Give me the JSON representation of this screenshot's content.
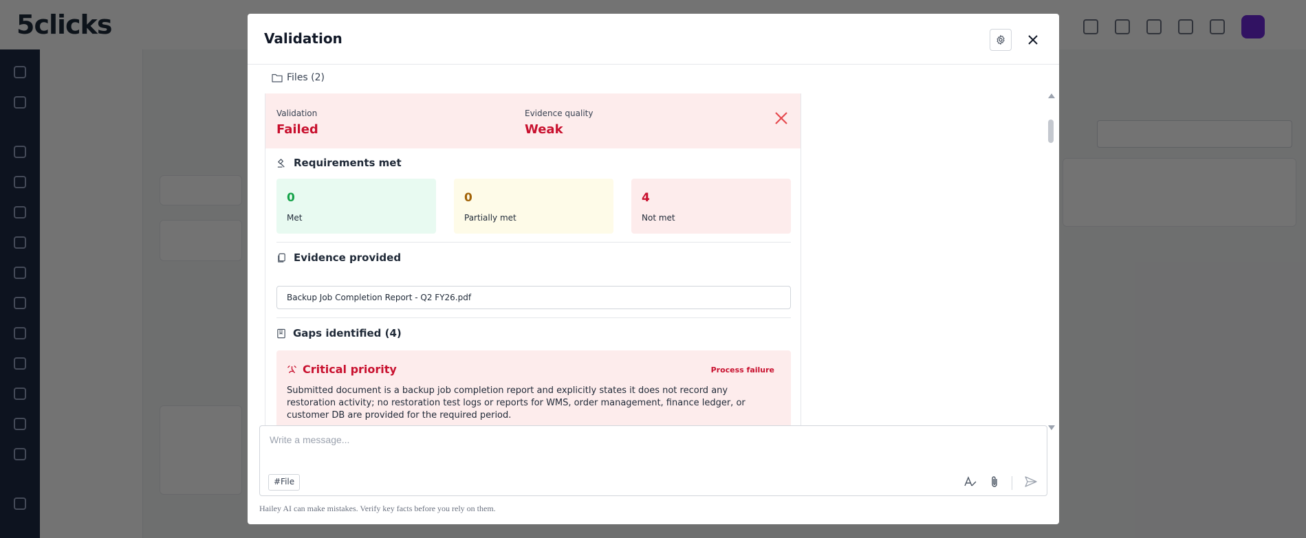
{
  "background": {
    "logo": "5clicks"
  },
  "modal": {
    "title": "Validation",
    "files_label": "Files (2)",
    "validation": {
      "label": "Validation",
      "value": "Failed",
      "quality_label": "Evidence quality",
      "quality_value": "Weak"
    },
    "requirements": {
      "heading": "Requirements met",
      "cards": [
        {
          "value": "0",
          "label": "Met",
          "color": "#16a34a",
          "bg": "#e8faf1"
        },
        {
          "value": "0",
          "label": "Partially met",
          "color": "#a16207",
          "bg": "#fefbe8"
        },
        {
          "value": "4",
          "label": "Not met",
          "color": "#c8102e",
          "bg": "#fdecec"
        }
      ]
    },
    "evidence": {
      "heading": "Evidence provided",
      "file": "Backup Job Completion Report - Q2 FY26.pdf"
    },
    "gaps": {
      "heading": "Gaps identified (4)",
      "items": [
        {
          "priority": "Critical priority",
          "tag": "Process failure",
          "text": "Submitted document is a backup job completion report and explicitly states it does not record any restoration activity; no restoration test logs or reports for WMS, order management, finance ledger, or customer DB are provided for the required period."
        }
      ]
    },
    "composer": {
      "placeholder": "Write a message...",
      "file_chip": "#File"
    },
    "disclaimer": "Hailey AI can make mistakes. Verify key facts before you rely on them."
  }
}
